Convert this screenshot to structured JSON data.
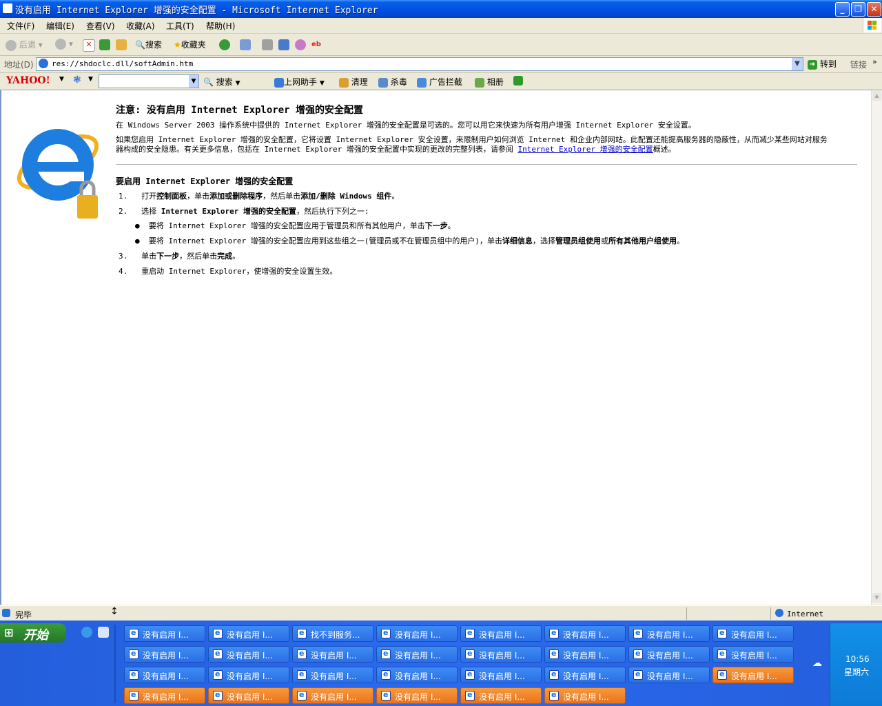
{
  "window": {
    "title": "没有启用 Internet Explorer 增强的安全配置 - Microsoft Internet Explorer"
  },
  "menu": [
    "文件(F)",
    "编辑(E)",
    "查看(V)",
    "收藏(A)",
    "工具(T)",
    "帮助(H)"
  ],
  "toolbar": {
    "back": "后退",
    "search": "搜索",
    "favorites": "收藏夹"
  },
  "address": {
    "label": "地址(D)",
    "value": "res://shdoclc.dll/softAdmin.htm",
    "go": "转到",
    "links": "链接"
  },
  "yahoobar": {
    "logo": "YAHOO!",
    "search": "搜索",
    "assistant": "上网助手",
    "clean": "清理",
    "antivirus": "杀毒",
    "adblock": "广告拦截",
    "album": "相册"
  },
  "content": {
    "heading": "注意: 没有启用 Internet Explorer 增强的安全配置",
    "p1": "在 Windows Server 2003 操作系统中提供的 Internet Explorer 增强的安全配置是可选的。您可以用它来快速为所有用户增强 Internet Explorer 安全设置。",
    "p2_line1": "如果您启用 Internet Explorer 增强的安全配置，它将设置 Internet Explorer 安全设置，来限制用户如何浏览 Internet 和企业内部网站。此配置还能提高服务器的隐蔽性，从而减少某些网站对服务",
    "p2_line2_pre": "器构成的安全隐患。有关更多信息，包括在 Internet Explorer 增强的安全配置中实现的更改的完整列表，请参阅",
    "p2_link": "Internet Explorer 增强的安全配置",
    "p2_line2_post": "概述。",
    "subheading": "要启用 Internet Explorer 增强的安全配置",
    "step1_num": "1.",
    "step1_a": "打开",
    "step1_b": "控制面板",
    "step1_c": "，单击",
    "step1_d": "添加或删除程序",
    "step1_e": "，然后单击",
    "step1_f": "添加/删除 Windows 组件",
    "step1_g": "。",
    "step2_num": "2.",
    "step2_a": "选择 ",
    "step2_b": "Internet Explorer 增强的安全配置",
    "step2_c": "，然后执行下列之一:",
    "bullet1_a": "要将 Internet Explorer 增强的安全配置应用于管理员和所有其他用户，单击",
    "bullet1_b": "下一步",
    "bullet1_c": "。",
    "bullet2_a": "要将 Internet Explorer 增强的安全配置应用到这些组之一(管理员或不在管理员组中的用户)，单击",
    "bullet2_b": "详细信息",
    "bullet2_c": "，选择",
    "bullet2_d": "管理员组使用",
    "bullet2_e": "或",
    "bullet2_f": "所有其他用户组使用",
    "bullet2_g": "。",
    "step3_num": "3.",
    "step3_a": "单击",
    "step3_b": "下一步",
    "step3_c": "，然后单击",
    "step3_d": "完成",
    "step3_e": "。",
    "step4_num": "4.",
    "step4_a": "重启动 Internet Explorer，使增强的安全设置生效。"
  },
  "status": {
    "text": "完毕",
    "zone": "Internet"
  },
  "taskbar": {
    "start": "开始",
    "clock_time": "10:56",
    "clock_day": "星期六",
    "tasks_row1": [
      "没有启用 I...",
      "没有启用 I...",
      "找不到服务...",
      "没有启用 I...",
      "没有启用 I...",
      "没有启用 I...",
      "没有启用 I...",
      "没有启用 I..."
    ],
    "tasks_row2": [
      "没有启用 I...",
      "没有启用 I...",
      "没有启用 I...",
      "没有启用 I...",
      "没有启用 I...",
      "没有启用 I...",
      "没有启用 I...",
      "没有启用 I..."
    ],
    "tasks_row3": [
      "没有启用 I...",
      "没有启用 I...",
      "没有启用 I...",
      "没有启用 I...",
      "没有启用 I...",
      "没有启用 I...",
      "没有启用 I...",
      "没有启用 I..."
    ],
    "tasks_row4": [
      "没有启用 I...",
      "没有启用 I...",
      "没有启用 I...",
      "没有启用 I...",
      "没有启用 I...",
      "没有启用 I..."
    ]
  }
}
